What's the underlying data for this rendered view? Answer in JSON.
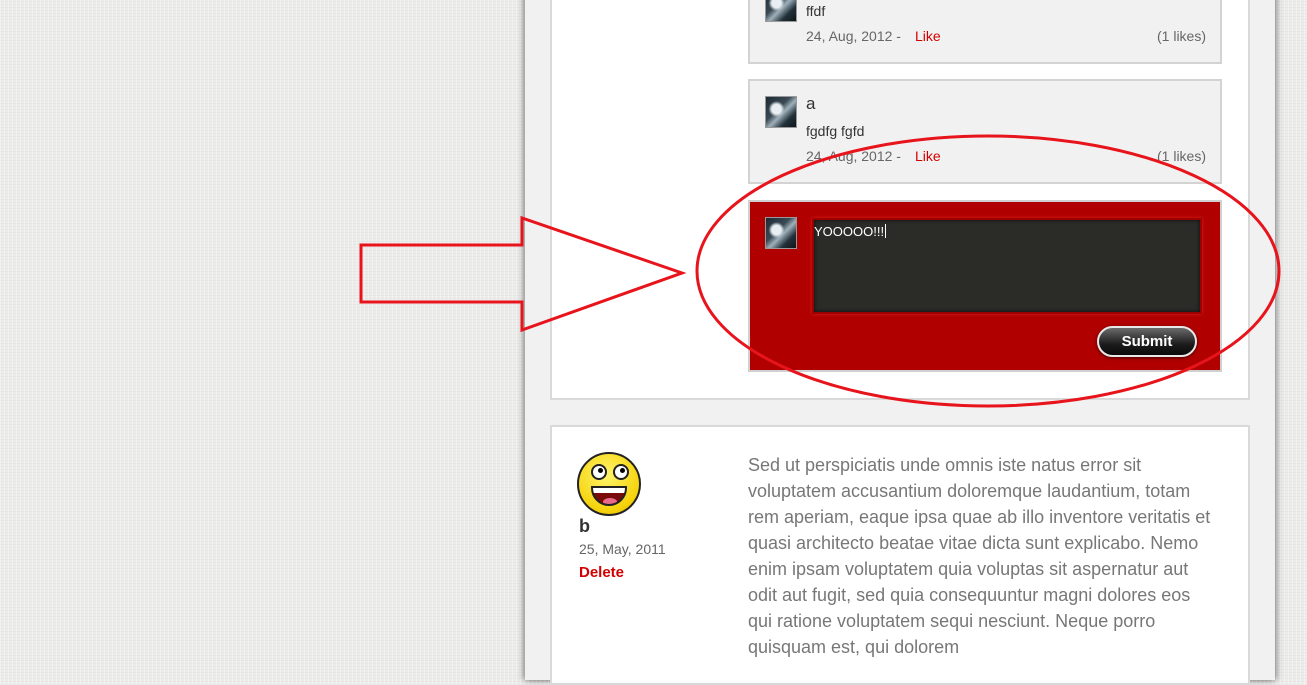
{
  "comments": [
    {
      "text": "ffdf",
      "date": "24, Aug, 2012 -",
      "like_label": "Like",
      "likes": "(1 likes)"
    },
    {
      "author": "a",
      "text": "fgdfg fgfd",
      "date": "24, Aug, 2012 -",
      "like_label": "Like",
      "likes": "(1 likes)"
    }
  ],
  "reply": {
    "value": "YOOOOO!!!",
    "submit_label": "Submit"
  },
  "post": {
    "author": "b",
    "date": "25, May, 2011",
    "delete_label": "Delete",
    "body": "Sed ut perspiciatis unde omnis iste natus error sit voluptatem accusantium doloremque laudantium, totam rem aperiam, eaque ipsa quae ab illo inventore veritatis et quasi architecto beatae vitae dicta sunt explicabo. Nemo enim ipsam voluptatem quia voluptas sit aspernatur aut odit aut fugit, sed quia consequuntur magni dolores eos qui ratione voluptatem sequi nesciunt. Neque porro quisquam est, qui dolorem"
  },
  "annotation": {
    "color": "#e8141c",
    "shapes": [
      "arrow",
      "ellipse"
    ]
  },
  "colors": {
    "accent": "#d40000",
    "reply_background": "#b00000"
  }
}
